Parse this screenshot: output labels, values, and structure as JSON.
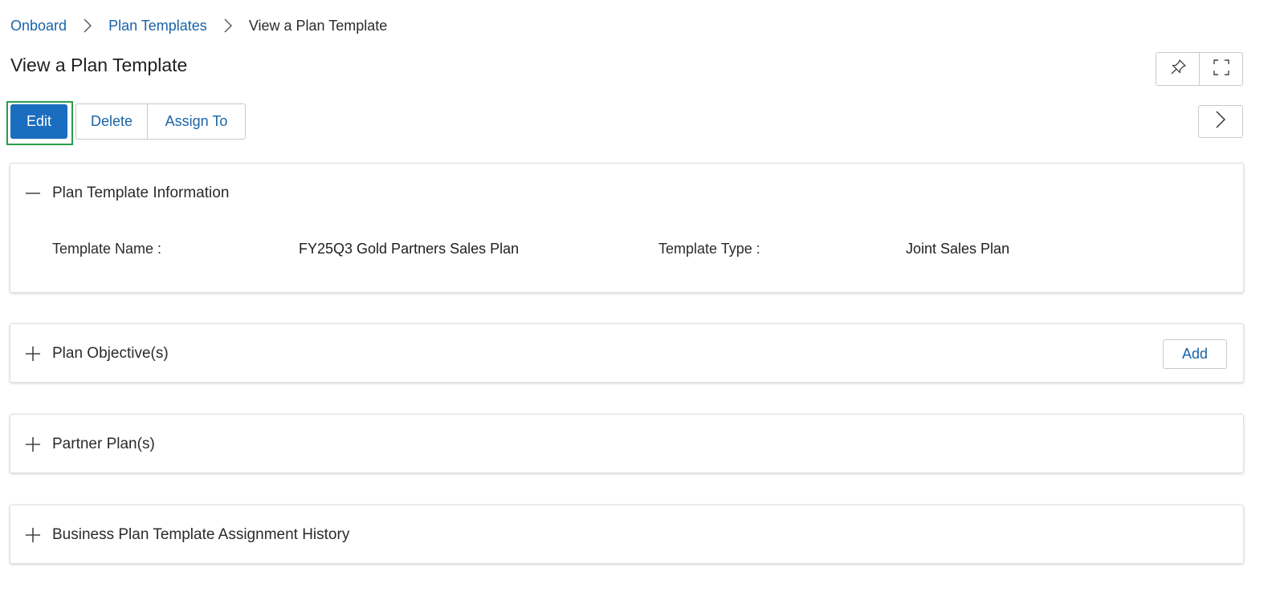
{
  "breadcrumb": {
    "items": [
      "Onboard",
      "Plan Templates"
    ],
    "current": "View a Plan Template"
  },
  "page": {
    "title": "View a Plan Template"
  },
  "toolbar": {
    "edit_label": "Edit",
    "delete_label": "Delete",
    "assign_label": "Assign To"
  },
  "icons": {
    "pin": "pin-icon",
    "fullscreen": "fullscreen-icon",
    "next": "chevron-right-icon",
    "collapse": "minus-icon",
    "expand": "plus-icon"
  },
  "colors": {
    "primary": "#1b6dbf",
    "link": "#1a63a8",
    "focus_outline": "#2a9d4b"
  },
  "sections": {
    "info": {
      "title": "Plan Template Information",
      "expanded": true,
      "fields": {
        "template_name_label": "Template Name :",
        "template_name_value": "FY25Q3 Gold Partners Sales Plan",
        "template_type_label": "Template Type :",
        "template_type_value": "Joint Sales Plan"
      }
    },
    "objectives": {
      "title": "Plan Objective(s)",
      "expanded": false,
      "add_label": "Add"
    },
    "partner_plans": {
      "title": "Partner Plan(s)",
      "expanded": false
    },
    "assignment_history": {
      "title": "Business Plan Template Assignment History",
      "expanded": false
    }
  }
}
